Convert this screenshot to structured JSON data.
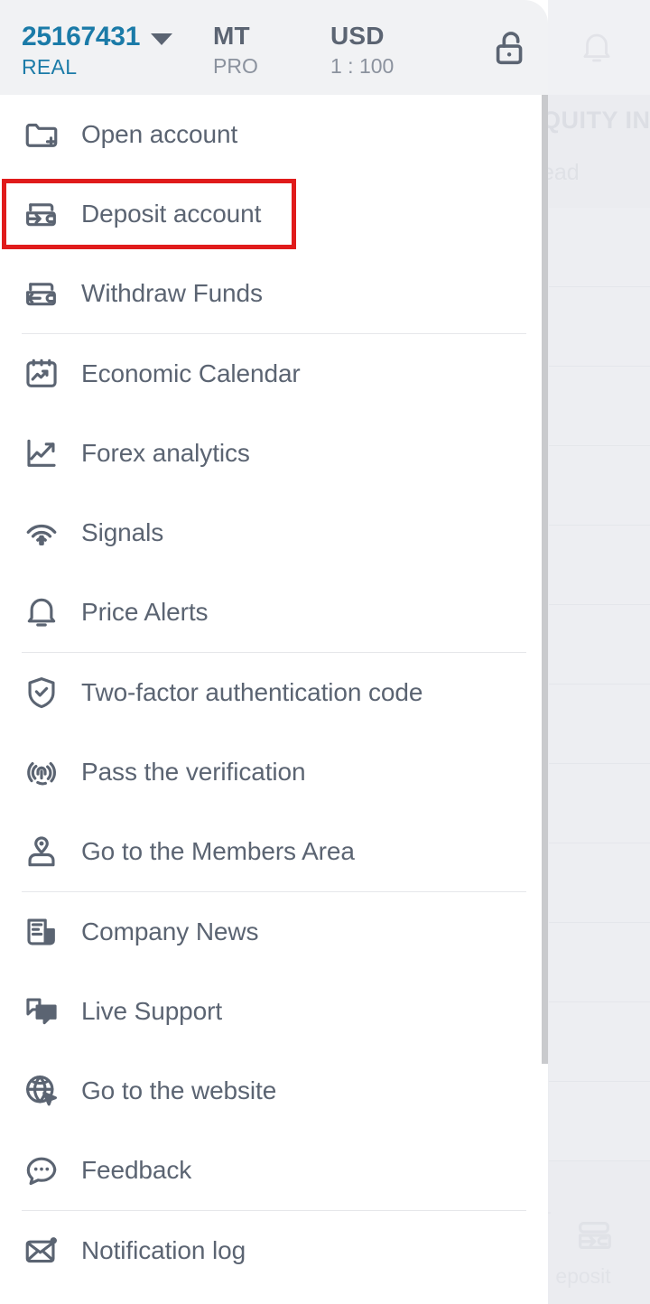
{
  "account": {
    "number": "25167431",
    "type": "REAL",
    "platform_label": "MT",
    "platform_sub": "PRO",
    "currency_label": "USD",
    "leverage": "1 : 100",
    "lock_icon": "unlocked-padlock-icon",
    "caret_icon": "chevron-down-icon"
  },
  "menu": {
    "items": [
      {
        "label": "Open account",
        "icon": "folder-plus-icon",
        "divider_after": false,
        "highlighted": false
      },
      {
        "label": "Deposit account",
        "icon": "wallet-arrow-in-icon",
        "divider_after": false,
        "highlighted": true
      },
      {
        "label": "Withdraw Funds",
        "icon": "wallet-arrow-out-icon",
        "divider_after": true,
        "highlighted": false
      },
      {
        "label": "Economic Calendar",
        "icon": "calendar-chart-icon",
        "divider_after": false,
        "highlighted": false
      },
      {
        "label": "Forex analytics",
        "icon": "line-chart-up-icon",
        "divider_after": false,
        "highlighted": false
      },
      {
        "label": "Signals",
        "icon": "broadcast-signal-icon",
        "divider_after": false,
        "highlighted": false
      },
      {
        "label": "Price Alerts",
        "icon": "bell-icon",
        "divider_after": true,
        "highlighted": false
      },
      {
        "label": "Two-factor authentication code",
        "icon": "shield-check-icon",
        "divider_after": false,
        "highlighted": false
      },
      {
        "label": "Pass the verification",
        "icon": "fingerprint-icon",
        "divider_after": false,
        "highlighted": false
      },
      {
        "label": "Go to the Members Area",
        "icon": "user-badge-icon",
        "divider_after": true,
        "highlighted": false
      },
      {
        "label": "Company News",
        "icon": "news-document-icon",
        "divider_after": false,
        "highlighted": false
      },
      {
        "label": "Live Support",
        "icon": "chat-bubbles-icon",
        "divider_after": false,
        "highlighted": false
      },
      {
        "label": "Go to the website",
        "icon": "globe-cursor-icon",
        "divider_after": false,
        "highlighted": false
      },
      {
        "label": "Feedback",
        "icon": "comment-dots-icon",
        "divider_after": true,
        "highlighted": false
      },
      {
        "label": "Notification log",
        "icon": "envelope-dot-icon",
        "divider_after": false,
        "highlighted": false
      }
    ]
  },
  "background": {
    "equity_text": "QUITY IN",
    "spread_text": "ead",
    "deposit_label": "eposit",
    "deposit_icon": "wallet-arrow-in-icon",
    "bell_icon": "bell-icon"
  },
  "colors": {
    "accent": "#1b7ba8",
    "text": "#5b6472",
    "muted": "#8b929e",
    "highlight": "#e01b1b",
    "header_bg": "#f1f2f4",
    "panel_bg": "#ffffff",
    "backdrop": "#ebecf0"
  }
}
